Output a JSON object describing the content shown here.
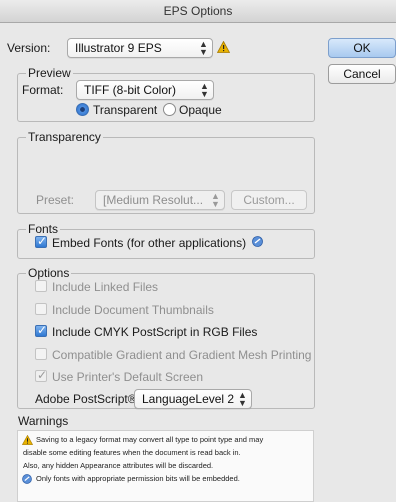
{
  "window": {
    "title": "EPS Options"
  },
  "version": {
    "label": "Version:",
    "value": "Illustrator 9 EPS"
  },
  "buttons": {
    "ok": "OK",
    "cancel": "Cancel"
  },
  "preview": {
    "legend": "Preview",
    "format_label": "Format:",
    "format_value": "TIFF (8-bit Color)",
    "transparent_label": "Transparent",
    "opaque_label": "Opaque",
    "selected": "transparent"
  },
  "transparency": {
    "legend": "Transparency",
    "preset_label": "Preset:",
    "preset_value": "[Medium Resolut...",
    "custom_label": "Custom..."
  },
  "fonts": {
    "legend": "Fonts",
    "embed_label": "Embed Fonts (for other applications)",
    "embed_checked": true
  },
  "options": {
    "legend": "Options",
    "items": [
      {
        "label": "Include Linked Files",
        "checked": false,
        "enabled": false
      },
      {
        "label": "Include Document Thumbnails",
        "checked": false,
        "enabled": false
      },
      {
        "label": "Include CMYK PostScript in RGB Files",
        "checked": true,
        "enabled": true
      },
      {
        "label": "Compatible Gradient and Gradient Mesh Printing",
        "checked": false,
        "enabled": false
      },
      {
        "label": "Use Printer's Default Screen",
        "checked": true,
        "enabled": false
      }
    ],
    "postscript_label": "Adobe PostScript®:",
    "postscript_value": "LanguageLevel 2"
  },
  "warnings": {
    "heading": "Warnings",
    "lines": [
      "Saving to a legacy format may convert all type to point type and may",
      "disable some editing features when the document is read back in.",
      "Also, any hidden Appearance attributes will be discarded.",
      "Only fonts with appropriate permission bits will be embedded."
    ]
  },
  "colors": {
    "warning": "#e0a400",
    "info": "#3b78d0",
    "default_button": "#a8c9ef"
  }
}
